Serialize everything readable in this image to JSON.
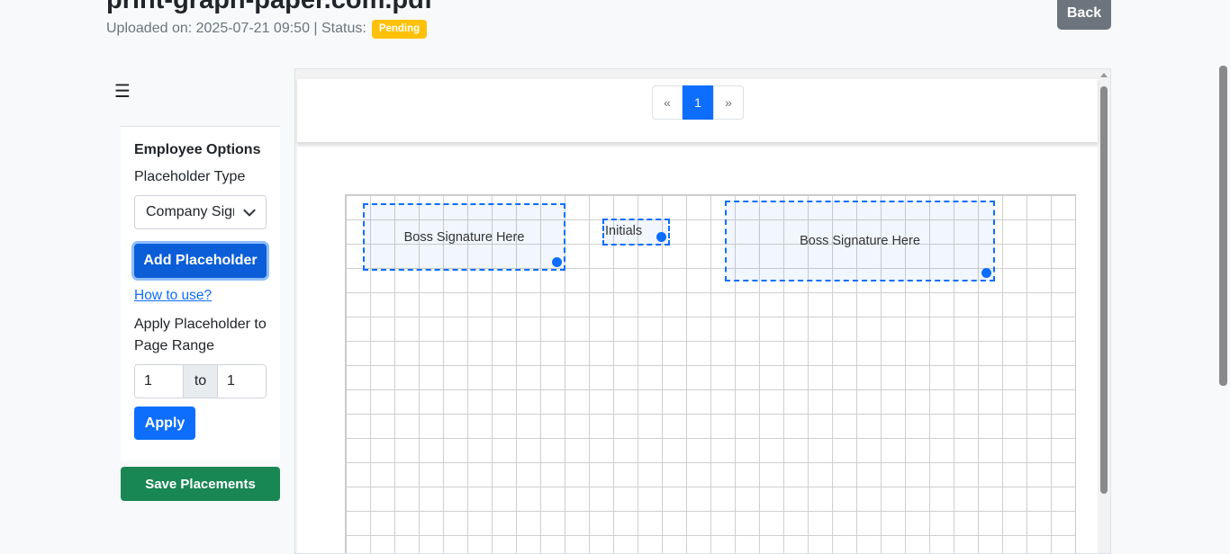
{
  "header": {
    "title": "print-graph-paper.com.pdf",
    "meta_text": "Uploaded on: 2025-07-21 09:50 | Status:",
    "status_badge": "Pending",
    "back_label": "Back"
  },
  "sidebar": {
    "menu_icon": "hamburger-icon",
    "heading": "Employee Options",
    "placeholder_type_label": "Placeholder Type",
    "placeholder_type_value": "Company Signature",
    "add_button": "Add Placeholder",
    "how_to_link": "How to use?",
    "range_label": "Apply Placeholder to Page Range",
    "range_from": "1",
    "range_to_label": "to",
    "range_to": "1",
    "apply_button": "Apply",
    "save_button": "Save Placements"
  },
  "viewer": {
    "pagination": {
      "prev": "«",
      "current": "1",
      "next": "»"
    },
    "placeholders": [
      {
        "label": "Boss Signature Here"
      },
      {
        "label": "Initials"
      },
      {
        "label": "Boss Signature Here"
      }
    ]
  },
  "colors": {
    "primary": "#0d6efd",
    "success": "#198754",
    "secondary": "#6c757d",
    "warning": "#ffc107"
  }
}
